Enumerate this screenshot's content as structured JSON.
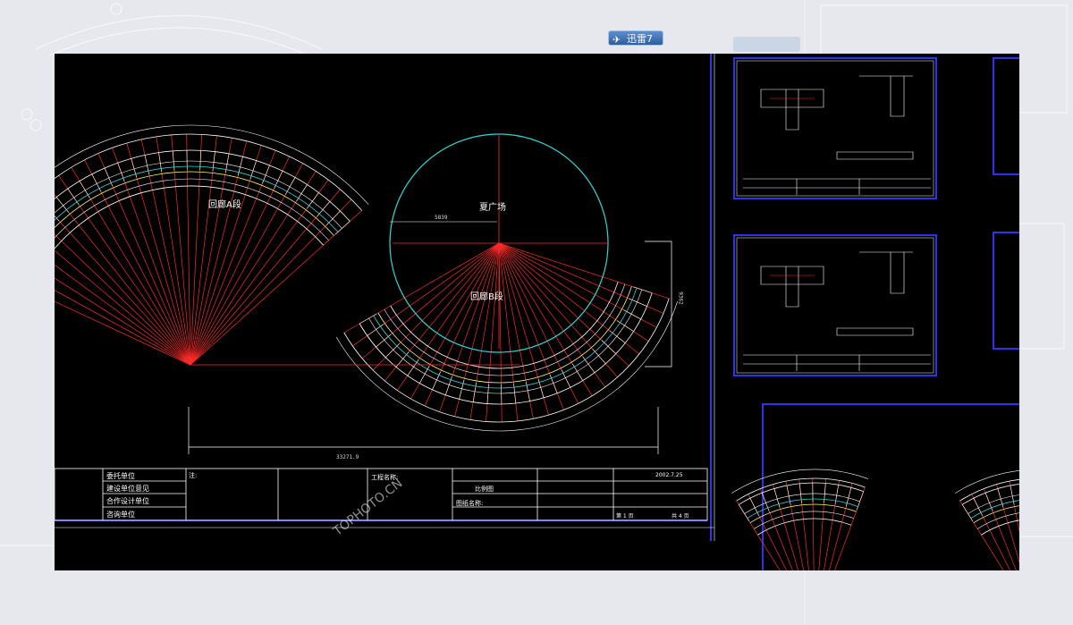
{
  "app": {
    "badge_label": "迅雷7",
    "watermark": "TOPHOTO.CN"
  },
  "drawing": {
    "arc1_label": "回廊A段",
    "arc2_label": "回廊B段",
    "circle_label": "夏广场",
    "dim_bottom": "33271.9",
    "dim_radius": "5839",
    "dim_right": "9362"
  },
  "title_block": {
    "left_rows": [
      "委托单位",
      "建设单位意见",
      "合作设计单位",
      "咨询单位"
    ],
    "note_label": "注:",
    "project_label": "工程名称:",
    "drawing_label": "图纸名称:",
    "scale_label": "比例图",
    "date": "2002.7.25",
    "sheet_label": "第 1 页",
    "total_label": "共 4 页"
  },
  "colors": {
    "red": "#ff2a2a",
    "yellow": "#ffff66",
    "cyan": "#2bd6d6",
    "blue": "#2b35e6",
    "white": "#ffffff"
  }
}
